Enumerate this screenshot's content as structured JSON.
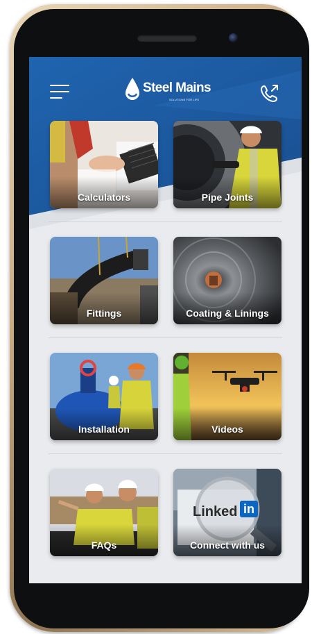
{
  "app": {
    "brand_name": "Steel Mains",
    "brand_tagline": "SOLUTIONS FOR LIFE",
    "brand_color": "#1b5da6",
    "screen_background": "#e9ebee"
  },
  "header": {
    "menu_icon": "hamburger-menu-icon",
    "call_icon": "phone-outgoing-icon"
  },
  "tiles": [
    {
      "label": "Calculators",
      "icon": "calculators-photo"
    },
    {
      "label": "Pipe Joints",
      "icon": "pipe-joints-photo"
    },
    {
      "label": "Fittings",
      "icon": "fittings-photo"
    },
    {
      "label": "Coating & Linings",
      "icon": "coating-linings-photo"
    },
    {
      "label": "Installation",
      "icon": "installation-photo"
    },
    {
      "label": "Videos",
      "icon": "videos-photo"
    },
    {
      "label": "FAQs",
      "icon": "faqs-photo"
    },
    {
      "label": "Connect with us",
      "icon": "linkedin-photo",
      "badge": "Linked",
      "badge_suffix": "in"
    }
  ]
}
